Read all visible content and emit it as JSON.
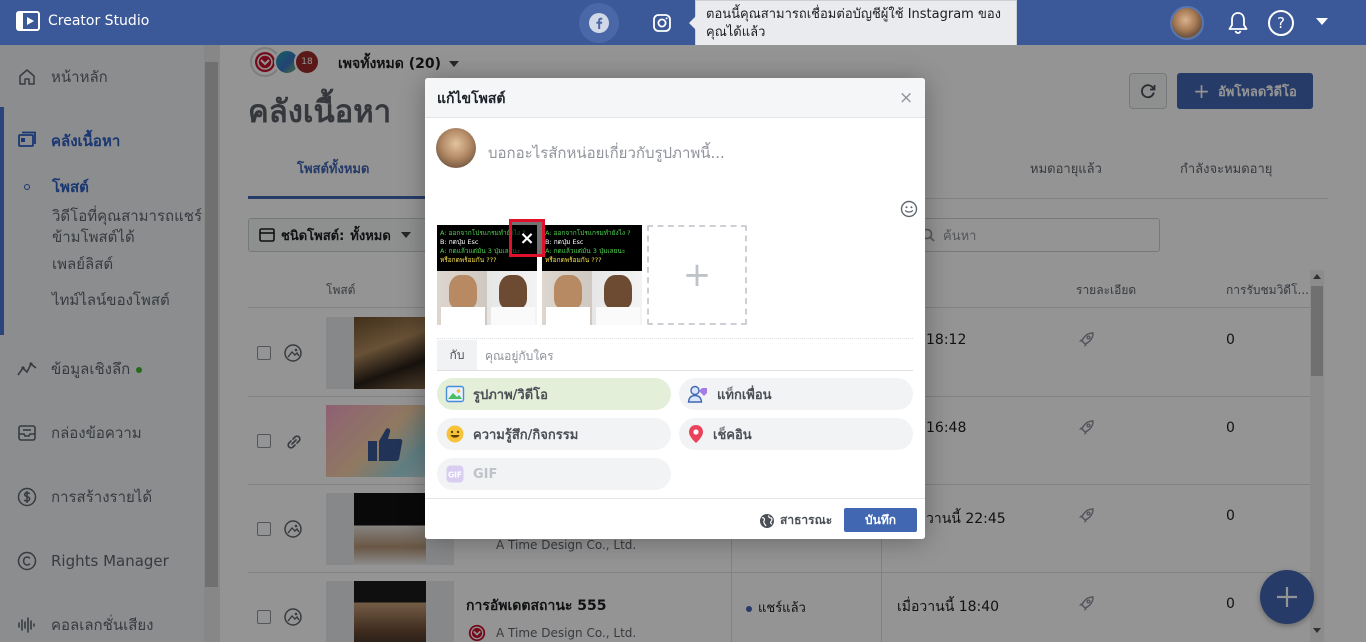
{
  "app": {
    "title": "Creator Studio"
  },
  "topbar": {
    "tooltip": "ตอนนี้คุณสามารถเชื่อมต่อบัญชีผู้ใช้ Instagram ของคุณได้แล้ว"
  },
  "sidebar": {
    "items": [
      {
        "label": "หน้าหลัก",
        "icon": "home-icon"
      },
      {
        "label": "คลังเนื้อหา",
        "icon": "content-library-icon"
      },
      {
        "label": "ข้อมูลเชิงลึก",
        "icon": "insights-icon"
      },
      {
        "label": "กล่องข้อความ",
        "icon": "inbox-icon"
      },
      {
        "label": "การสร้างรายได้",
        "icon": "monetization-icon"
      },
      {
        "label": "Rights Manager",
        "icon": "copyright-icon"
      },
      {
        "label": "คอลเลกชั่นเสียง",
        "icon": "audio-icon"
      }
    ],
    "subitems": [
      "โพสต์",
      "วิดีโอที่คุณสามารถแชร์ข้ามโพสต์ได้",
      "เพลย์ลิสต์",
      "ไทม์ไลน์ของโพสต์"
    ]
  },
  "main": {
    "page_count_badge": "18",
    "page_selector": "เพจทั้งหมด (20)",
    "title": "คลังเนื้อหา",
    "upload_label": "อัพโหลดวิดีโอ",
    "tabs": [
      "โพสต์ทั้งหมด",
      "หมดอายุแล้ว",
      "กำลังจะหมดอายุ"
    ],
    "filter_label": "ชนิดโพสต์:",
    "filter_value": "ทั้งหมด",
    "search_placeholder": "ค้นหา",
    "columns": [
      "โพสต์",
      "รายละเอียด",
      "การรับชมวิดีโ..."
    ],
    "rows": [
      {
        "time": "18:12",
        "views": "0",
        "title": "",
        "page": "",
        "status": ""
      },
      {
        "time": "16:48",
        "views": "0",
        "title": "",
        "page": "",
        "status": ""
      },
      {
        "time": "วานนี้ 22:45",
        "views": "0",
        "title": "",
        "page": "A Time Design Co., Ltd.",
        "status": ""
      },
      {
        "time": "เมื่อวานนี้ 18:40",
        "views": "0",
        "title": "การอัพเดตสถานะ 555",
        "page": "A Time Design Co., Ltd.",
        "status": "แชร์แล้ว"
      }
    ]
  },
  "modal": {
    "title": "แก้ไขโพสต์",
    "close": "×",
    "placeholder": "บอกอะไรสักหน่อยเกี่ยวกับรูปภาพนี้...",
    "remove_media": "×",
    "add_media": "+",
    "meme_lines": [
      "A: ออกจากโปรแกรมทำยังไง ?",
      "B: กดปุ่ม Esc",
      "A: กดแล้วแต่มัน 3 ปุ่มเลยนะ",
      "หรือกดพร้อมกัน ???"
    ],
    "with_label": "กับ",
    "with_placeholder": "คุณอยู่กับใคร",
    "options": [
      {
        "label": "รูปภาพ/วิดีโอ",
        "icon": "photo-video-icon"
      },
      {
        "label": "แท็กเพื่อน",
        "icon": "tag-friends-icon"
      },
      {
        "label": "ความรู้สึก/กิจกรรม",
        "icon": "feeling-icon"
      },
      {
        "label": "เช็คอิน",
        "icon": "checkin-pin-icon"
      },
      {
        "label": "GIF",
        "icon": "gif-icon"
      }
    ],
    "privacy": "สาธารณะ",
    "save": "บันทึก"
  },
  "colors": {
    "topbar": "#3b5998",
    "accent": "#4267b2",
    "highlight": "#e0112b"
  }
}
